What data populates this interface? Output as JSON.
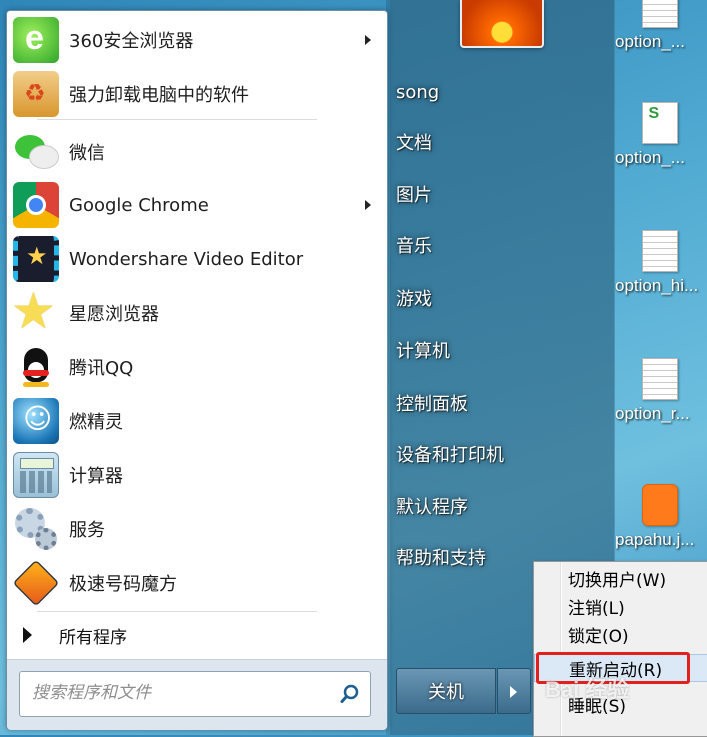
{
  "programs": [
    {
      "label": "360安全浏览器",
      "icon": "360-browser-icon",
      "has_submenu": true
    },
    {
      "label": "强力卸载电脑中的软件",
      "icon": "uninstaller-icon",
      "has_submenu": false
    },
    {
      "label": "微信",
      "icon": "wechat-icon",
      "has_submenu": false
    },
    {
      "label": "Google Chrome",
      "icon": "chrome-icon",
      "has_submenu": true
    },
    {
      "label": "Wondershare Video Editor",
      "icon": "wondershare-icon",
      "has_submenu": false
    },
    {
      "label": "星愿浏览器",
      "icon": "star-browser-icon",
      "has_submenu": false
    },
    {
      "label": "腾讯QQ",
      "icon": "qq-icon",
      "has_submenu": false
    },
    {
      "label": "燃精灵",
      "icon": "ranjingling-icon",
      "has_submenu": false
    },
    {
      "label": "计算器",
      "icon": "calculator-icon",
      "has_submenu": false
    },
    {
      "label": "服务",
      "icon": "services-icon",
      "has_submenu": false
    },
    {
      "label": "极速号码魔方",
      "icon": "cube-icon",
      "has_submenu": false
    }
  ],
  "all_programs_label": "所有程序",
  "search": {
    "placeholder": "搜索程序和文件"
  },
  "right_items": [
    "song",
    "文档",
    "图片",
    "音乐",
    "游戏",
    "计算机",
    "控制面板",
    "设备和打印机",
    "默认程序",
    "帮助和支持"
  ],
  "shutdown": {
    "label": "关机"
  },
  "power_menu": [
    {
      "label": "切换用户(W)"
    },
    {
      "label": "注销(L)"
    },
    {
      "label": "锁定(O)"
    },
    {
      "label": "重新启动(R)",
      "highlighted": true
    },
    {
      "label": "睡眠(S)"
    }
  ],
  "desktop_icons": [
    "option_...",
    "option_...",
    "option_hi...",
    "option_r...",
    "papahu.j..."
  ],
  "watermark": "Bai 经验",
  "colors": {
    "highlight_box": "#e3201b",
    "menu_highlight": "#dbe9f7"
  }
}
